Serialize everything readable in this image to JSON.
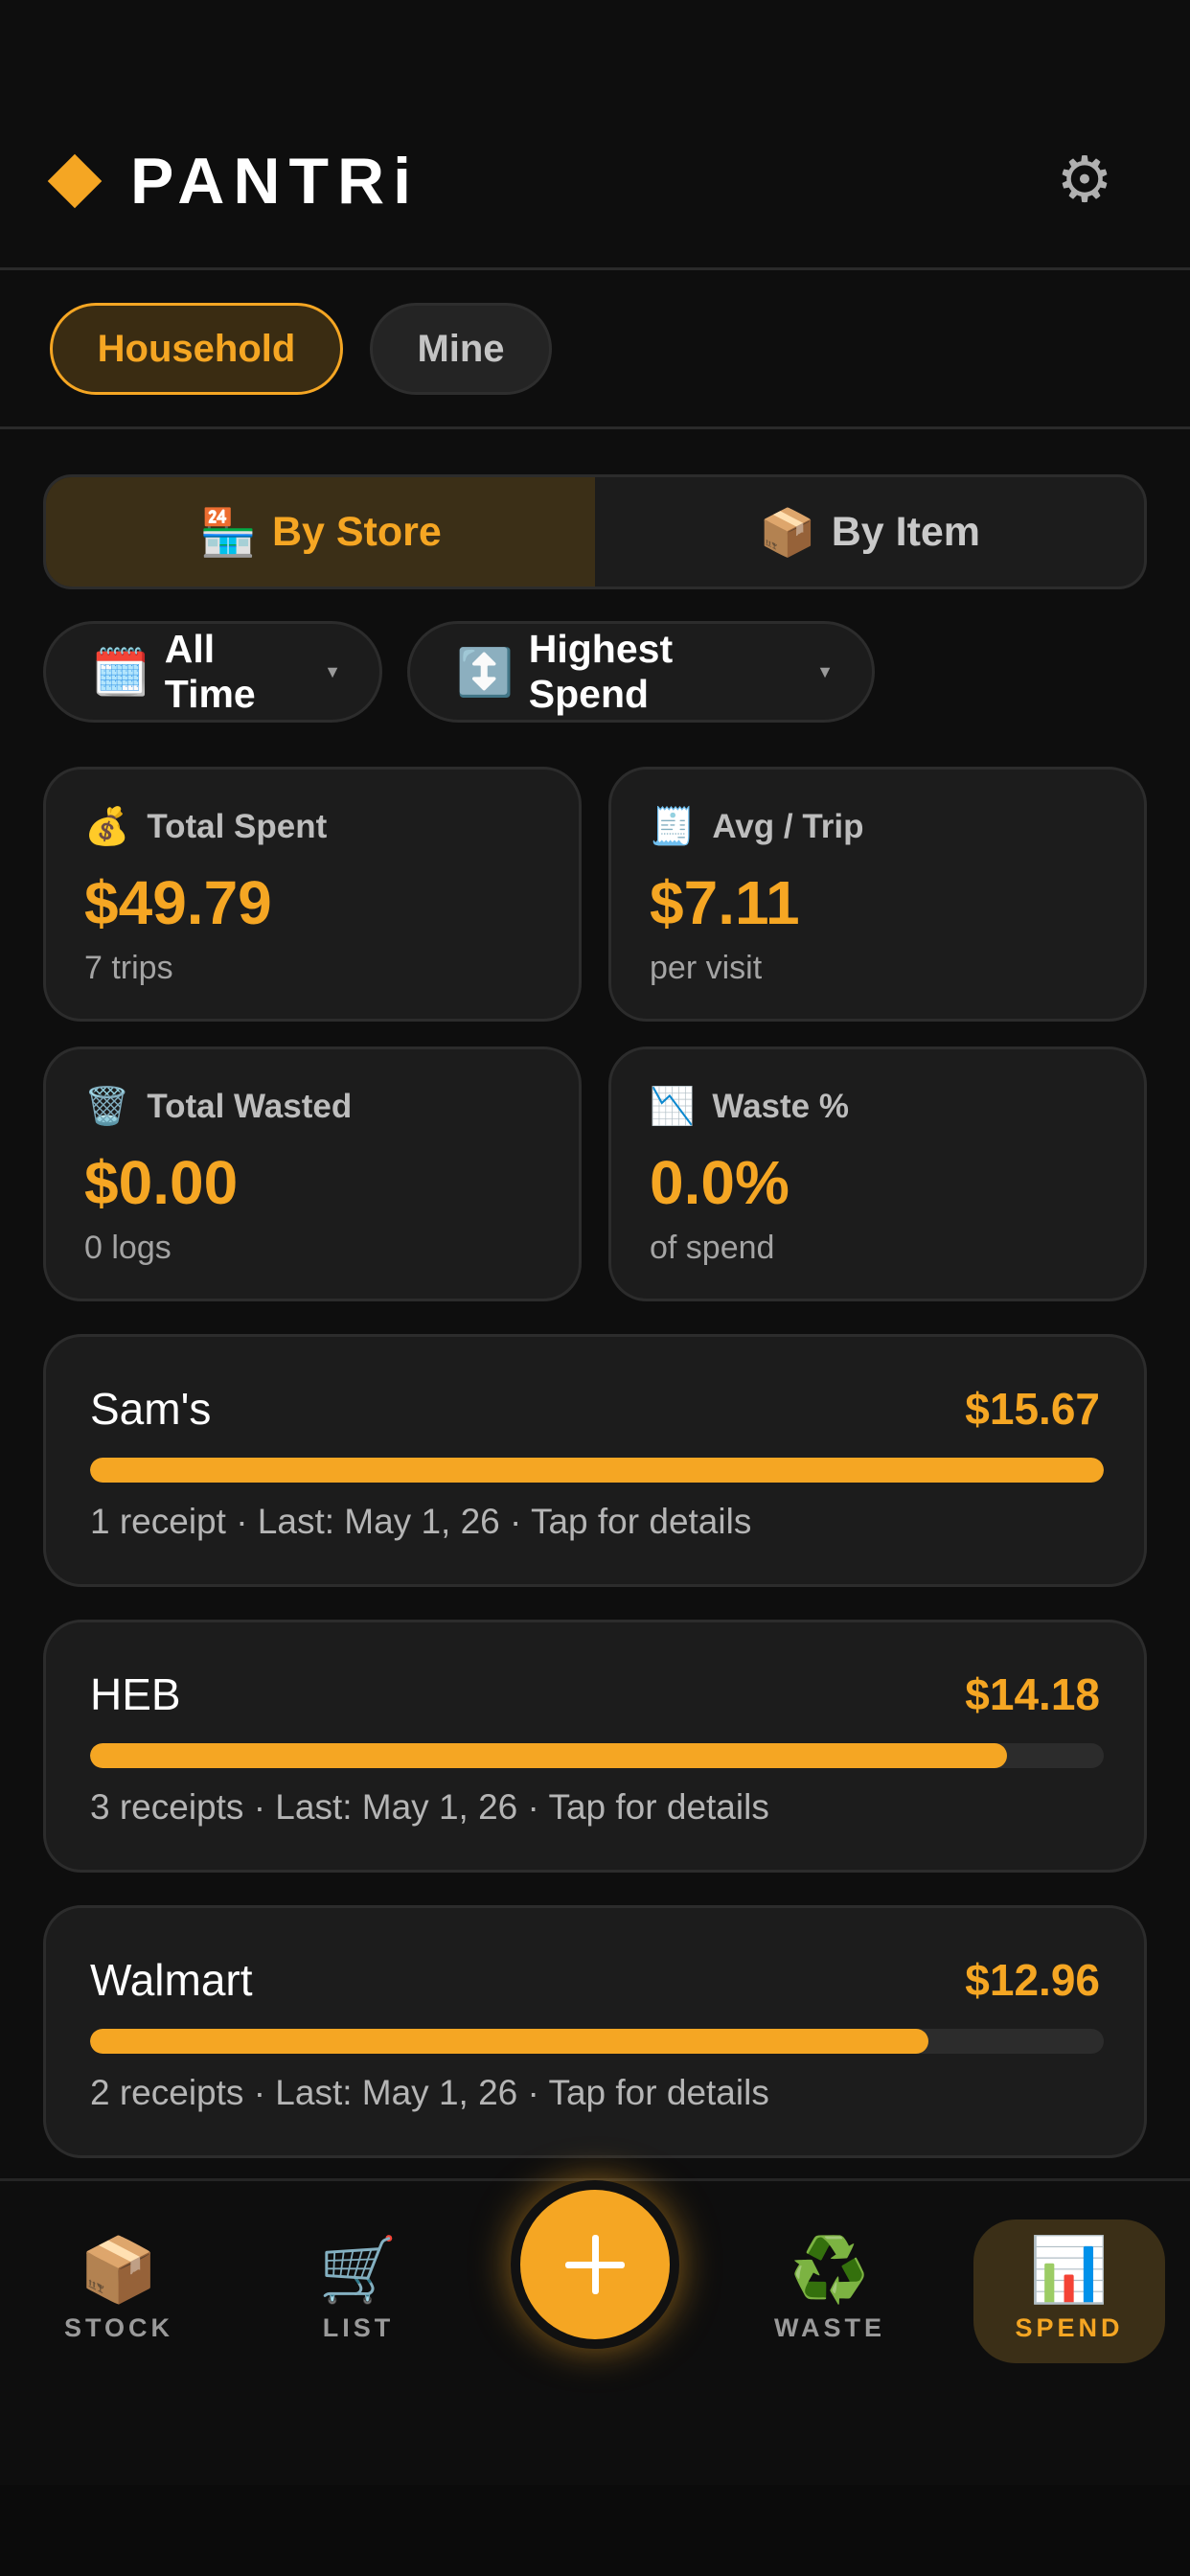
{
  "app": {
    "title": "PANTRi",
    "settings_icon": "gear-icon"
  },
  "scope": {
    "household": "Household",
    "mine": "Mine",
    "selected": "Household"
  },
  "view_toggle": {
    "by_store": {
      "icon": "🏪",
      "label": "By Store"
    },
    "by_item": {
      "icon": "📦",
      "label": "By Item"
    },
    "selected": "By Store"
  },
  "filters": {
    "time": {
      "icon": "🗓️",
      "label": "All Time",
      "caret": "▼"
    },
    "sort": {
      "icon": "↕️",
      "label": "Highest Spend",
      "caret": "▼"
    }
  },
  "stats": {
    "total_spent": {
      "icon": "💰",
      "label": "Total Spent",
      "value": "$49.79",
      "sub": "7 trips"
    },
    "avg_trip": {
      "icon": "🧾",
      "label": "Avg / Trip",
      "value": "$7.11",
      "sub": "per visit"
    },
    "total_wasted": {
      "icon": "🗑️",
      "label": "Total Wasted",
      "value": "$0.00",
      "sub": "0 logs"
    },
    "waste_pct": {
      "icon": "📉",
      "label": "Waste %",
      "value": "0.0%",
      "sub": "of spend"
    }
  },
  "stores": [
    {
      "name": "Sam's",
      "amount": "$15.67",
      "fraction": 1.0,
      "meta": "1 receipt · Last: May 1, 26 · Tap for details"
    },
    {
      "name": "HEB",
      "amount": "$14.18",
      "fraction": 0.905,
      "meta": "3 receipts · Last: May 1, 26 · Tap for details"
    },
    {
      "name": "Walmart",
      "amount": "$12.96",
      "fraction": 0.827,
      "meta": "2 receipts · Last: May 1, 26 · Tap for details"
    }
  ],
  "nav": {
    "stock": {
      "icon": "📦",
      "label": "STOCK"
    },
    "list": {
      "icon": "🛒",
      "label": "LIST"
    },
    "add": {
      "icon": "plus-icon"
    },
    "waste": {
      "icon": "♻️",
      "label": "WASTE"
    },
    "spend": {
      "icon": "📊",
      "label": "SPEND"
    },
    "active": "SPEND"
  },
  "colors": {
    "accent": "#f5a623",
    "background": "#0e0e0e",
    "card": "#1c1c1c"
  }
}
